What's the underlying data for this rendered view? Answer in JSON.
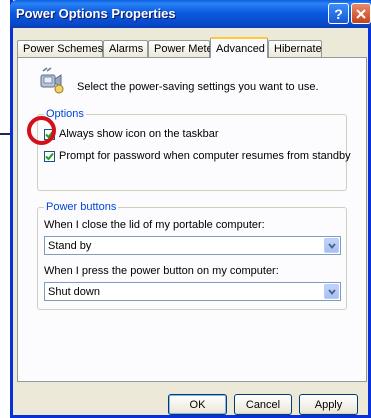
{
  "window": {
    "title": "Power Options Properties"
  },
  "tabs": [
    {
      "label": "Power Schemes"
    },
    {
      "label": "Alarms"
    },
    {
      "label": "Power Meter"
    },
    {
      "label": "Advanced"
    },
    {
      "label": "Hibernate"
    }
  ],
  "active_tab": "Advanced",
  "header_text": "Select the power-saving settings you want to use.",
  "options": {
    "legend": "Options",
    "items": [
      {
        "label": "Always show icon on the taskbar",
        "checked": true
      },
      {
        "label": "Prompt for password when computer resumes from standby",
        "checked": true
      }
    ]
  },
  "power_buttons": {
    "legend": "Power buttons",
    "lid_label": "When I close the lid of my portable computer:",
    "lid_value": "Stand by",
    "power_label": "When I press the power button on my computer:",
    "power_value": "Shut down"
  },
  "buttons": {
    "ok": "OK",
    "cancel": "Cancel",
    "apply": "Apply"
  },
  "colors": {
    "accent": "#0831d9",
    "annotation": "#d4111b",
    "legend_text": "#0046d5"
  },
  "icons": [
    "help-icon",
    "close-icon",
    "power-settings-icon",
    "checkmark-icon",
    "chevron-down-icon"
  ]
}
